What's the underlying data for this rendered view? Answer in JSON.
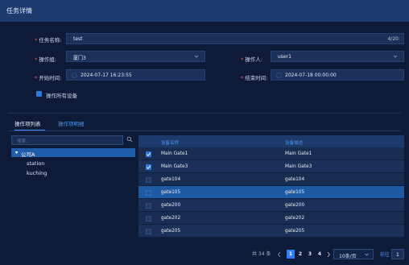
{
  "dialog": {
    "title": "任务详情"
  },
  "form": {
    "task_name": {
      "label": "任务名称:",
      "value": "test",
      "counter": "4/20"
    },
    "operation_group": {
      "label": "操作组:",
      "value": "厦门3"
    },
    "operator": {
      "label": "操作人:",
      "value": "user1"
    },
    "start_time": {
      "label": "开始时间:",
      "value": "2024-07-17 16:23:55"
    },
    "end_time": {
      "label": "结束时间:",
      "value": "2024-07-18 00:00:00"
    },
    "operate_all_devices": {
      "label": "操作所有设备",
      "checked": true
    }
  },
  "tabs": [
    {
      "label": "操作项列表",
      "active": true
    },
    {
      "label": "操作项明细",
      "active": false
    }
  ],
  "tree": {
    "search_placeholder": "搜索...",
    "nodes": [
      {
        "label": "公司A",
        "expanded": true,
        "selected": true
      },
      {
        "label": "station"
      },
      {
        "label": "kuching"
      }
    ]
  },
  "table": {
    "columns": [
      "设备名称",
      "设备描述"
    ],
    "rows": [
      {
        "name": "Main Gate1",
        "desc": "Main Gate1",
        "checked": true
      },
      {
        "name": "Main Gate3",
        "desc": "Main Gate3",
        "checked": true
      },
      {
        "name": "gate104",
        "desc": "gate104",
        "checked": false
      },
      {
        "name": "gate105",
        "desc": "gate105",
        "checked": false,
        "highlighted": true
      },
      {
        "name": "gate200",
        "desc": "gate200",
        "checked": false
      },
      {
        "name": "gate202",
        "desc": "gate202",
        "checked": false
      },
      {
        "name": "gate205",
        "desc": "gate205",
        "checked": false
      }
    ]
  },
  "pagination": {
    "total_text": "共 34 条",
    "pages": [
      "1",
      "2",
      "3",
      "4"
    ],
    "current_page": "1",
    "page_size": "10条/页",
    "goto_label": "前往",
    "goto_value": "1"
  },
  "colors": {
    "accent": "#2f7df1",
    "required": "#ff4d4f",
    "header_bar": "#1d3a6e",
    "selected_row": "#1e5aa2"
  }
}
